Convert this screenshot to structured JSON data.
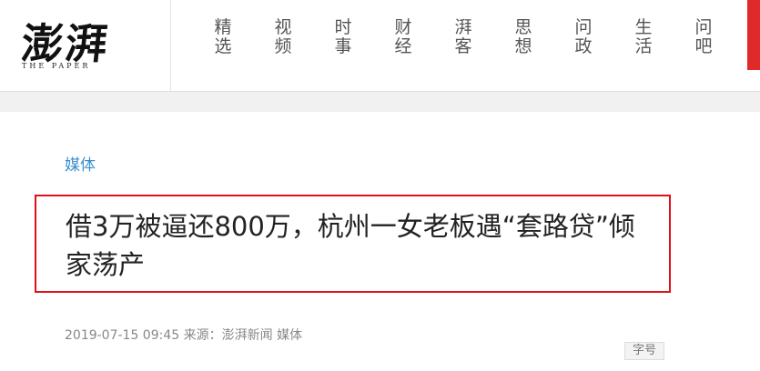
{
  "logo": {
    "main": "澎湃",
    "sub": "THE PAPER"
  },
  "nav": {
    "items": [
      {
        "line1": "精",
        "line2": "选"
      },
      {
        "line1": "视",
        "line2": "频"
      },
      {
        "line1": "时",
        "line2": "事"
      },
      {
        "line1": "财",
        "line2": "经"
      },
      {
        "line1": "湃",
        "line2": "客"
      },
      {
        "line1": "思",
        "line2": "想"
      },
      {
        "line1": "问",
        "line2": "政"
      },
      {
        "line1": "生",
        "line2": "活"
      },
      {
        "line1": "问",
        "line2": "吧"
      }
    ]
  },
  "article": {
    "category": "媒体",
    "title": "借3万被逼还800万，杭州一女老板遇“套路贷”倾家荡产",
    "date": "2019-07-15 09:45",
    "source_label": "来源：",
    "source": "澎湃新闻 媒体",
    "fontsize_button": "字号"
  },
  "colors": {
    "accent_blue": "#3a8fcf",
    "highlight_red": "#e0101a",
    "tab_red": "#e02929"
  }
}
